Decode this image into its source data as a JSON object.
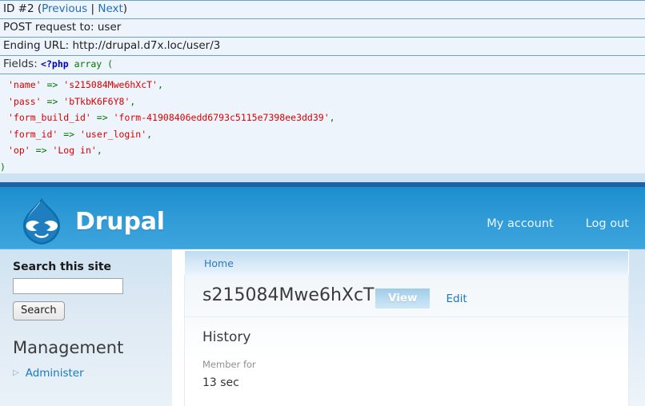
{
  "request_info": {
    "id_line": {
      "prefix": "ID #2 (",
      "previous_label": "Previous",
      "separator": " | ",
      "next_label": "Next",
      "suffix": ")"
    },
    "post_request": "POST request to: user",
    "ending_url": "Ending URL: http://drupal.d7x.loc/user/3",
    "fields_label": "Fields:",
    "php_open_tag": "<?php",
    "php_array_open": "array (",
    "php_array_close": ")",
    "array_entries": [
      {
        "key": "'name'",
        "arrow": "=>",
        "value": "'s215084Mwe6hXcT'",
        "comma": ","
      },
      {
        "key": "'pass'",
        "arrow": "=>",
        "value": "'bTkbK6F6Y8'",
        "comma": ","
      },
      {
        "key": "'form_build_id'",
        "arrow": "=>",
        "value": "'form-41908406edd6793c5115e7398ee3dd39'",
        "comma": ","
      },
      {
        "key": "'form_id'",
        "arrow": "=>",
        "value": "'user_login'",
        "comma": ","
      },
      {
        "key": "'op'",
        "arrow": "=>",
        "value": "'Log in'",
        "comma": ","
      }
    ]
  },
  "site": {
    "name": "Drupal",
    "logo_icon": "drupal-droplet-logo",
    "user_nav": [
      {
        "label": "My account"
      },
      {
        "label": "Log out"
      }
    ],
    "breadcrumb": {
      "home_label": "Home"
    },
    "sidebar": {
      "search_block": {
        "title": "Search this site",
        "input_value": "",
        "input_placeholder": "",
        "button_label": "Search"
      },
      "management_block": {
        "title": "Management",
        "items": [
          {
            "label": "Administer",
            "bullet_icon": "triangle-right-icon"
          }
        ]
      }
    },
    "main": {
      "page_title": "s215084Mwe6hXcT",
      "tabs": [
        {
          "label": "View",
          "active": true
        },
        {
          "label": "Edit",
          "active": false
        }
      ],
      "history": {
        "heading": "History",
        "member_for_label": "Member for",
        "member_for_value": "13 sec"
      }
    }
  },
  "colors": {
    "header_blue": "#2e9ad6",
    "band_dark_blue": "#1b63a5",
    "band_light_blue": "#cde2f2",
    "link_blue": "#1878c1",
    "panel_border_blue": "#6ba3c8",
    "req_bg": "#eef4fb",
    "php_string_red": "#dd0000",
    "php_keyword_green": "#007700",
    "php_tag_blue": "#0000bb"
  }
}
